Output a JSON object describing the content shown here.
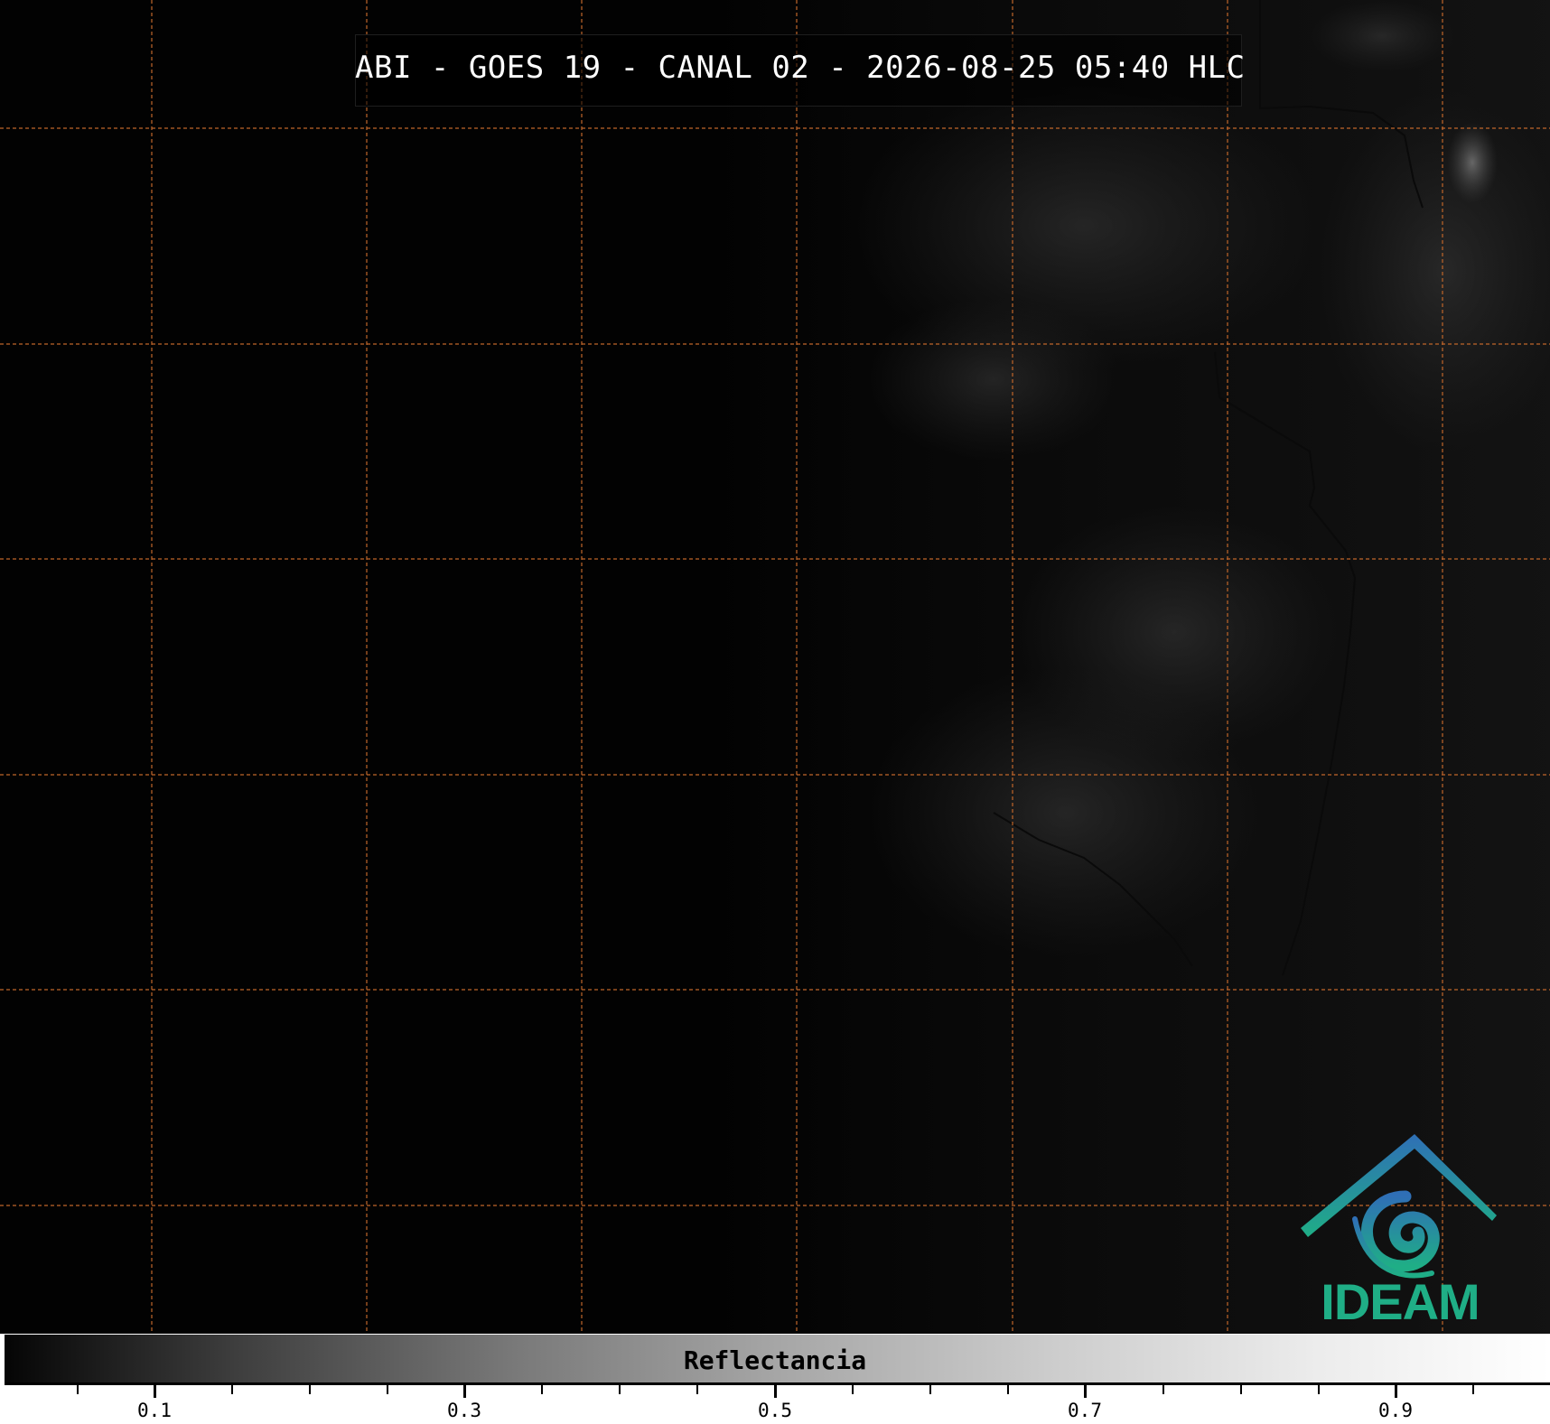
{
  "header": {
    "title": "ABI - GOES 19 - CANAL 02 - 2026-08-25 05:40 HLC"
  },
  "map": {
    "background_color": "#020202",
    "gridline_color": "#c0662a",
    "gridline_style": "dashed",
    "boundary_color": "#0a0a0a"
  },
  "logo": {
    "text": "IDEAM",
    "icon": "ideam-mountain-swirl-icon",
    "colors": {
      "top": "#2f6fb6",
      "bottom": "#1fae86"
    }
  },
  "colorbar": {
    "label": "Reflectancia",
    "colormap": "grayscale",
    "range": [
      0.0,
      1.0
    ],
    "major_ticks": [
      "0.1",
      "0.3",
      "0.5",
      "0.7",
      "0.9"
    ],
    "minor_tick_step": 0.05
  }
}
